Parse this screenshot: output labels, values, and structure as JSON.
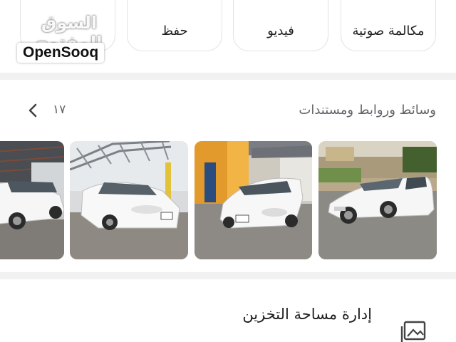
{
  "actions": {
    "call_label": "مكالمة صوتية",
    "video_label": "فيديو",
    "save_label": "حفظ"
  },
  "watermark": {
    "arabic": "السوق المفتوح",
    "logo": "OpenSooq"
  },
  "media": {
    "title": "وسائط وروابط ومستندات",
    "count": "١٧"
  },
  "thumbnails": [
    {
      "alt": "white sedan parked by yellow building"
    },
    {
      "alt": "white sedan front view outside shop"
    },
    {
      "alt": "white sedan under metal canopy"
    },
    {
      "alt": "white sedan side view under shade"
    }
  ],
  "storage": {
    "title": "إدارة مساحة التخزين"
  },
  "colors": {
    "accent": "#1e8e3e",
    "divider": "#f1f1f1",
    "secondary_text": "#5f6368"
  }
}
